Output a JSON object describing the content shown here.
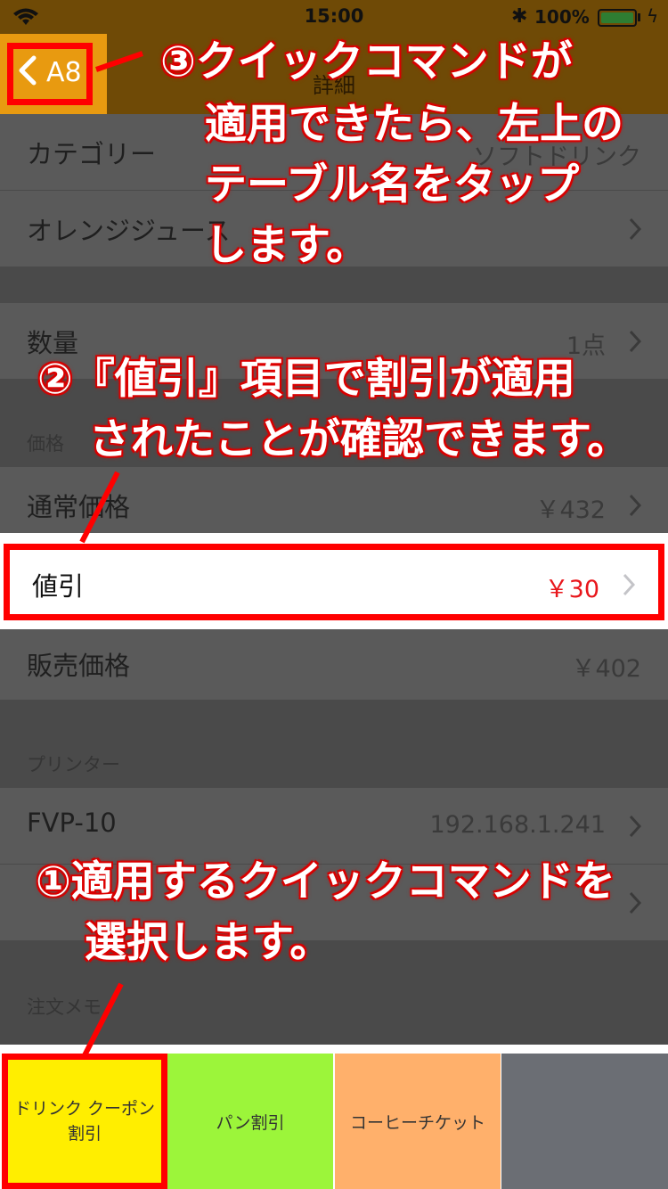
{
  "status_bar": {
    "time": "15:00",
    "battery_percent": "100%",
    "bluetooth_icon": "bluetooth-icon",
    "wifi_icon": "wifi-icon",
    "charging_icon": "bolt-icon"
  },
  "nav": {
    "title": "詳細",
    "back_label": "A8"
  },
  "rows": {
    "category": {
      "label": "カテゴリー",
      "value": "ソフトドリンク"
    },
    "item": {
      "label": "オレンジジュース"
    },
    "quantity": {
      "label": "数量",
      "value": "1点"
    },
    "price_section": "価格",
    "regular_price": {
      "label": "通常価格",
      "value": "￥432"
    },
    "discount": {
      "label": "値引",
      "value": "￥30"
    },
    "sale_price": {
      "label": "販売価格",
      "value": "￥402"
    },
    "printer_section": "プリンター",
    "printer": {
      "label": "FVP-10",
      "value": "192.168.1.241"
    },
    "memo_section": "注文メモ"
  },
  "quick_commands": [
    {
      "line1": "ドリンク クーポン",
      "line2": "割引"
    },
    {
      "label": "パン割引"
    },
    {
      "label": "コーヒーチケット"
    },
    {
      "label": ""
    }
  ],
  "annotations": {
    "step3": [
      "③クイックコマンドが",
      "適用できたら、左上の",
      "テーブル名をタップ",
      "します。"
    ],
    "step2": [
      "②『値引』項目で割引が適用",
      "されたことが確認できます。"
    ],
    "step1": [
      "①適用するクイックコマンドを",
      "選択します。"
    ]
  },
  "colors": {
    "accent_orange": "#e89a10",
    "highlight_red": "#ff0000",
    "discount_red": "#e8161b",
    "qc_yellow": "#ffee00",
    "qc_green": "#9cf53a",
    "qc_orange": "#ffb06b",
    "qc_gray": "#6b6e74"
  }
}
